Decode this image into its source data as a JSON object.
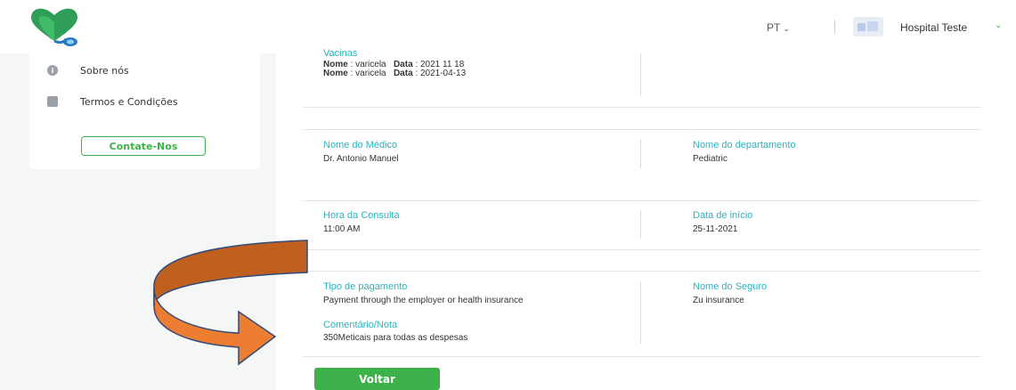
{
  "header": {
    "language": "PT",
    "hospital_name": "Hospital Teste"
  },
  "sidebar": {
    "items": [
      {
        "label": "Sobre nós",
        "icon": "info-icon"
      },
      {
        "label": "Termos e Condições",
        "icon": "document-icon"
      }
    ],
    "contact_label": "Contate-Nos"
  },
  "details": {
    "vaccines": {
      "title": "Vacinas",
      "entries": [
        {
          "name_label": "Nome",
          "name": "varicela",
          "date_label": "Data",
          "date": "2021 11 18"
        },
        {
          "name_label": "Nome",
          "name": "varicela",
          "date_label": "Data",
          "date": "2021-04-13"
        }
      ]
    },
    "doctor_label": "Nome do Médico",
    "doctor_value": "Dr. Antonio Manuel",
    "department_label": "Nome do departamento",
    "department_value": "Pediatric",
    "time_label": "Hora da Consulta",
    "time_value": "11:00 AM",
    "start_label": "Data de início",
    "start_value": "25-11-2021",
    "payment_label": "Tipo de pagamento",
    "payment_value": "Payment through the employer or health insurance",
    "insurance_label": "Nome do Seguro",
    "insurance_value": "Zu insurance",
    "comment_label": "Comentário/Nota",
    "comment_value": "350Meticais para todas as despesas"
  },
  "back_label": "Voltar",
  "colors": {
    "accent_green": "#3db24b",
    "label_teal": "#2db3bc",
    "arrow_orange": "#ed7d31",
    "arrow_brown": "#c0601f",
    "arrow_outline": "#2f4b7c"
  }
}
